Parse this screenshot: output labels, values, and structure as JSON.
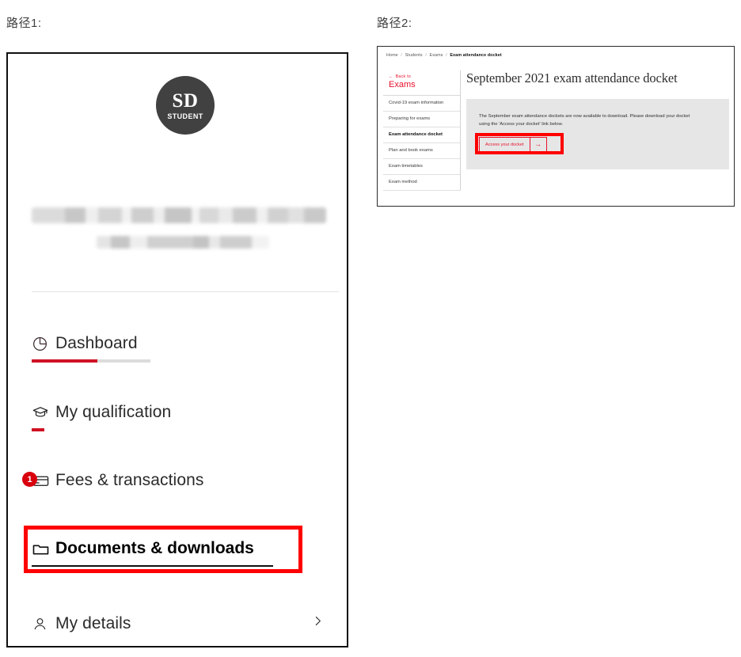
{
  "captions": {
    "left": "路径1:",
    "right": "路径2:"
  },
  "left_panel": {
    "avatar": {
      "initials": "SD",
      "role": "STUDENT",
      "background_color": "#414141"
    },
    "redacted_lines": 2,
    "menu": [
      {
        "label": "Dashboard",
        "icon": "pie-chart-icon",
        "underline": {
          "total_width": 150,
          "filled_width": 83,
          "color": "#cf1124"
        }
      },
      {
        "label": "My qualification",
        "icon": "graduation-cap-icon",
        "underline": {
          "total_width": 16,
          "filled_width": 16,
          "color": "#cf1124"
        }
      },
      {
        "label": "Fees & transactions",
        "icon": "card-icon",
        "badge": "1",
        "badge_color": "#d9000d"
      },
      {
        "label": "Documents & downloads",
        "icon": "folder-icon",
        "highlighted": true,
        "highlight_color": "#ff0000"
      },
      {
        "label": "My details",
        "icon": "person-icon",
        "chevron": "chevron-right-icon"
      }
    ]
  },
  "right_panel": {
    "breadcrumb": {
      "items": [
        "Home",
        "Students",
        "Exams"
      ],
      "current": "Exam attendance docket",
      "separator": "/"
    },
    "sidebar": {
      "back_label": "Back to",
      "back_target": "Exams",
      "back_arrow": "←",
      "accent_color": "#e8112d",
      "items": [
        {
          "label": "Covid-19 exam information",
          "active": false
        },
        {
          "label": "Preparing for exams",
          "active": false
        },
        {
          "label": "Exam attendance docket",
          "active": true
        },
        {
          "label": "Plan and book exams",
          "active": false
        },
        {
          "label": "Exam timetables",
          "active": false
        },
        {
          "label": "Exam method",
          "active": false
        }
      ]
    },
    "main": {
      "heading": "September 2021 exam attendance docket",
      "body": "The September exam attendance dockets are now available to download. Please download your docket using the 'Access your docket' link below.",
      "button": {
        "label": "Access your docket",
        "arrow": "→",
        "highlighted": true,
        "highlight_color": "#ff0000",
        "border_color": "#e8112d"
      }
    }
  }
}
